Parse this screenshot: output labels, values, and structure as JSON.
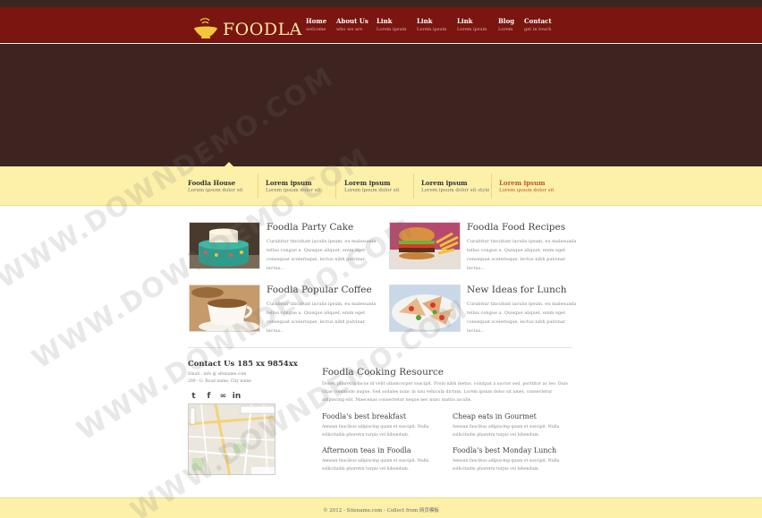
{
  "brand": {
    "name": "FOODLA"
  },
  "nav": [
    {
      "title": "Home",
      "sub": "welcome"
    },
    {
      "title": "About Us",
      "sub": "who we are"
    },
    {
      "title": "Link",
      "sub": "Lorem ipsum"
    },
    {
      "title": "Link",
      "sub": "Lorem ipsum"
    },
    {
      "title": "Link",
      "sub": "Lorem ipsum"
    },
    {
      "title": "Blog",
      "sub": "Lorem"
    },
    {
      "title": "Contact",
      "sub": "get in touch"
    }
  ],
  "tabs": [
    {
      "title": "Foodla House",
      "sub": "Lorem ipsum dolor sit"
    },
    {
      "title": "Lorem ipsum",
      "sub": "Lorem ipsum dolor sit"
    },
    {
      "title": "Lorem ipsum",
      "sub": "Lorem ipsum dolor sit"
    },
    {
      "title": "Lorem ipsum",
      "sub": "Lorem ipsum dolor sit style"
    },
    {
      "title": "Lorem ipsum",
      "sub": "Lorem ipsum dolor sit",
      "active": true
    }
  ],
  "cards": [
    {
      "title": "Foodla Party Cake",
      "text": "Curabitur tincidunt iaculis ipsum, eu malesuada tellus congue a. Quisque aliquet, enim eget consequat scelerisque, lectus nibh pulvinar lectus..."
    },
    {
      "title": "Foodla Food Recipes",
      "text": "Curabitur tincidunt iaculis ipsum, eu malesuada tellus congue a. Quisque aliquet, enim eget consequat scelerisque, lectus nibh pulvinar lectus..."
    },
    {
      "title": "Foodla Popular Coffee",
      "text": "Curabitur tincidunt iaculis ipsum, eu malesuada tellus congue a. Quisque aliquet, enim eget consequat scelerisque, lectus nibh pulvinar lectus..."
    },
    {
      "title": "New Ideas for Lunch",
      "text": "Curabitur tincidunt iaculis ipsum, eu malesuada tellus congue a. Quisque aliquet, enim eget consequat scelerisque, lectus nibh pulvinar lectus..."
    }
  ],
  "contact": {
    "title": "Contact Us 185 xx 9854xx",
    "email": "Email : info @ sitename.com",
    "address": "209 - G. Road name, City name"
  },
  "social": [
    "t",
    "f",
    "∞",
    "in"
  ],
  "resource": {
    "title": "Foodla Cooking Resource",
    "text": "Donec pharetra lacus id velit ullamcorper suscipit. Proin nibh metus, volutpat a auctor sed, porttitor ac leo. Duis vitae commodo augue. Sed sodales nunc in nisi vehicula dictum. Lorem ipsum dolor sit amet, consectetur adipiscing elit. Maecenas consectetur neque nec nunc mattis iaculis.",
    "items": [
      {
        "title": "Foodla's best breakfast",
        "text": "Aenean faucibus adipiscing quam et suscipit. Nulla sollicitudin pharetra turpis vel bibendum."
      },
      {
        "title": "Cheap eats in Gourmet",
        "text": "Aenean faucibus adipiscing quam et suscipit. Nulla sollicitudin pharetra turpis vel bibendum."
      },
      {
        "title": "Afternoon teas in Foodla",
        "text": "Aenean faucibus adipiscing quam et suscipit. Nulla sollicitudin pharetra turpis vel bibendum."
      },
      {
        "title": "Foodla's best Monday Lunch",
        "text": "Aenean faucibus adipiscing quam et suscipit. Nulla sollicitudin pharetra turpis vel bibendum."
      }
    ]
  },
  "footer": {
    "text": "© 2012 - Sitename.com - Collect from 网页模板"
  },
  "watermark": {
    "text": "WWW.DOWNDEMO.COM"
  },
  "colors": {
    "header": "#7a1510",
    "hero": "#3d2420",
    "tabs": "#fdf0a9",
    "logo_text": "#f7e6a6",
    "active_tab": "#c0582a"
  }
}
